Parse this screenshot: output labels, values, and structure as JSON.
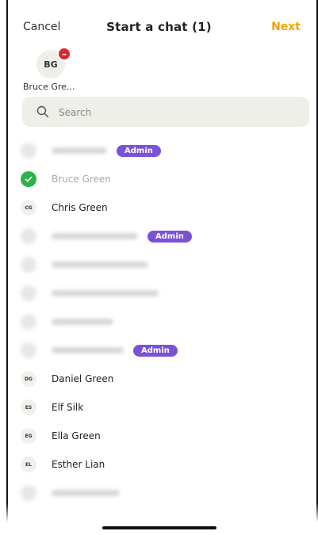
{
  "header": {
    "cancel_label": "Cancel",
    "title": "Start a chat (1)",
    "next_label": "Next"
  },
  "selected": {
    "initials": "BG",
    "name": "Bruce Gre..."
  },
  "search": {
    "placeholder": "Search"
  },
  "contacts": [
    {
      "initials": "",
      "name": "",
      "blurred": true,
      "admin_label": "Admin"
    },
    {
      "initials": "",
      "name": "Bruce Green",
      "selected": true
    },
    {
      "initials": "CG",
      "name": "Chris Green"
    },
    {
      "initials": "",
      "name": "",
      "blurred": true,
      "admin_label": "Admin"
    },
    {
      "initials": "",
      "name": "",
      "blurred": true
    },
    {
      "initials": "",
      "name": "",
      "blurred": true
    },
    {
      "initials": "",
      "name": "",
      "blurred": true
    },
    {
      "initials": "",
      "name": "",
      "blurred": true,
      "admin_label": "Admin"
    },
    {
      "initials": "DG",
      "name": "Daniel Green"
    },
    {
      "initials": "ES",
      "name": "Elf Silk"
    },
    {
      "initials": "EG",
      "name": "Ella Green"
    },
    {
      "initials": "EL",
      "name": "Esther Lian"
    },
    {
      "initials": "",
      "name": "",
      "blurred": true
    }
  ],
  "colors": {
    "accent": "#f2a400",
    "admin_badge": "#7a52d8",
    "selected_check": "#2ab34b",
    "remove_badge": "#d8282d"
  }
}
